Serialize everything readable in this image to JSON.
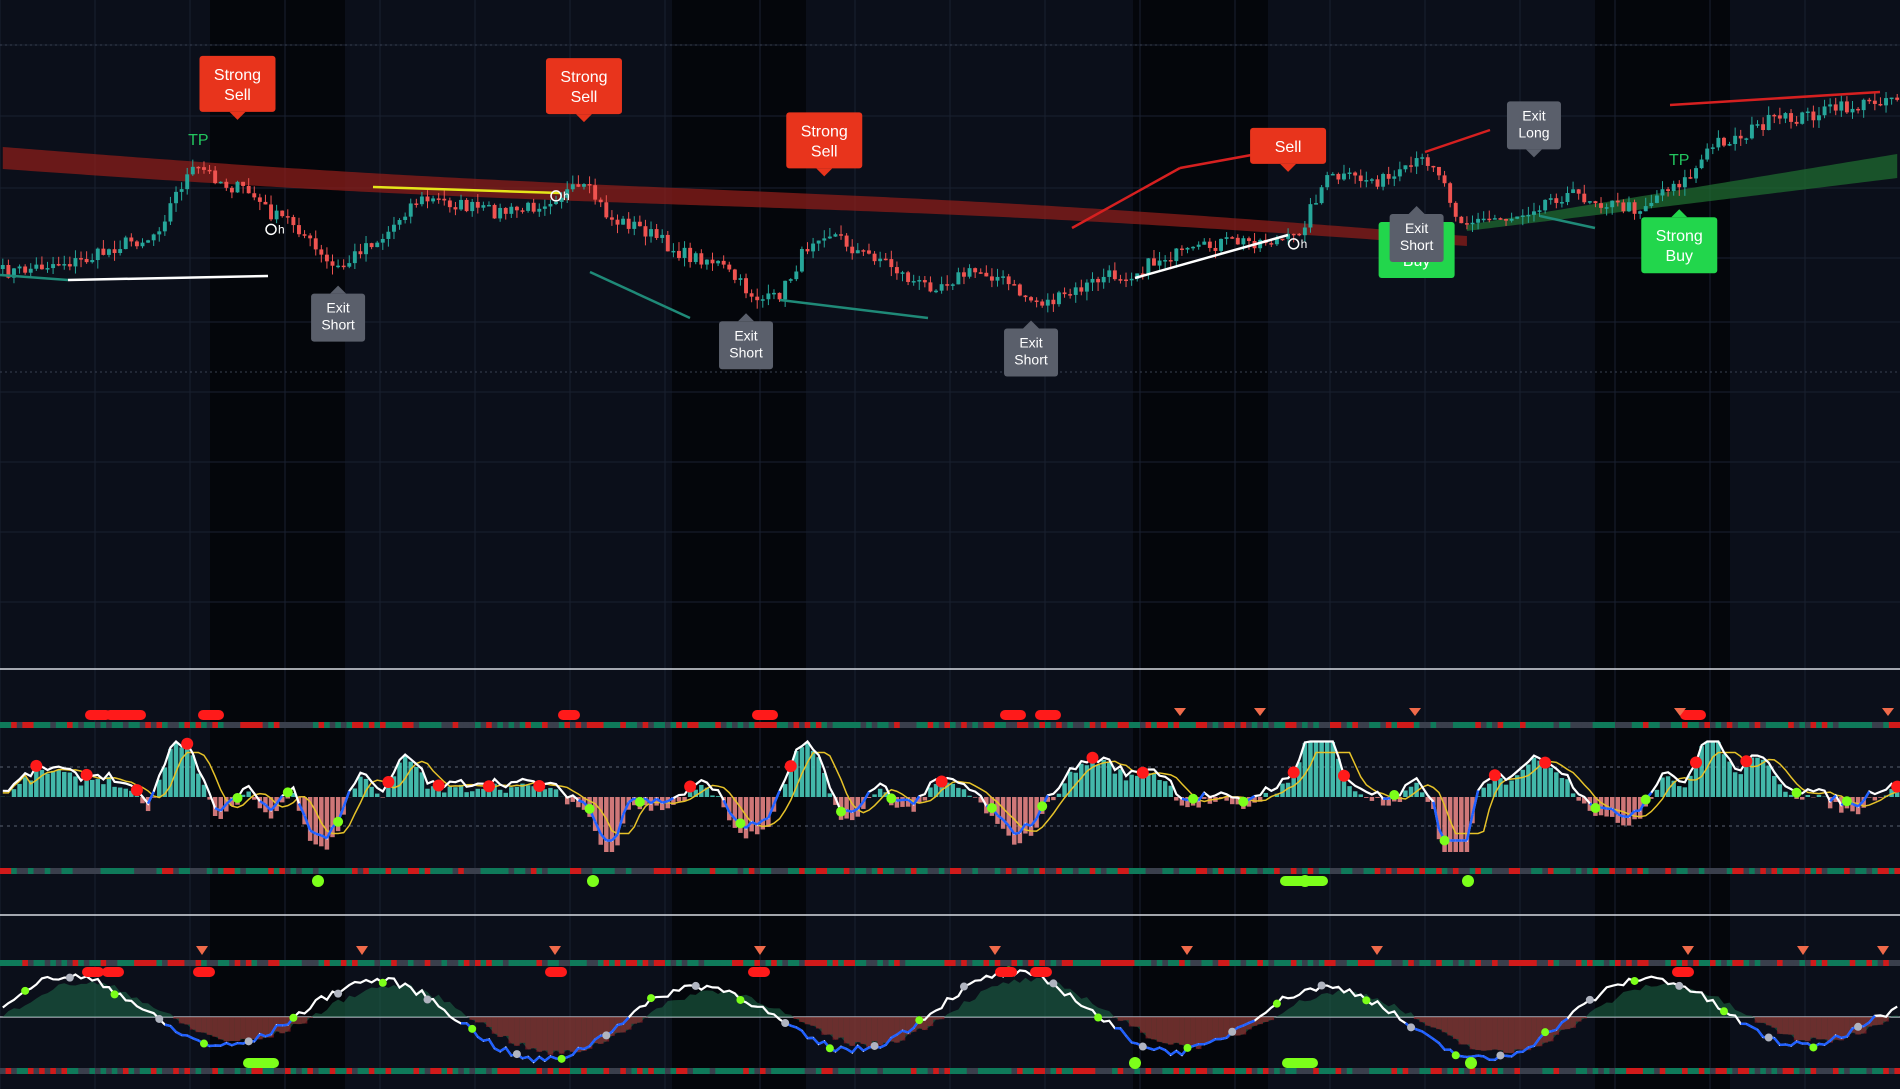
{
  "colors": {
    "background": "#0b0f1a",
    "shade": "#000000",
    "candle_up": "#26a69a",
    "candle_down": "#ef5350",
    "red_ribbon": "#8b1e1a",
    "green_ribbon": "#1f6b30",
    "sell_label": "#e8341c",
    "buy_label": "#22d64c",
    "exit_label": "#5a5f6b",
    "histogram_up": "#4dd6c4",
    "histogram_down": "#f28b8b",
    "wave_white": "#ffffff",
    "wave_blue": "#2060ff",
    "signal_yellow": "#e6c229",
    "dot_red": "#ff1a1a",
    "dot_green": "#7cff1a",
    "divergence_red": "#d62020",
    "divergence_white": "#ffffff",
    "divergence_teal": "#1f8a78",
    "divergence_yellow": "#e5e51a"
  },
  "chart_data": [
    {
      "type": "candlestick",
      "panel": "price",
      "signals": [
        {
          "text": [
            "Strong",
            "Sell"
          ],
          "kind": "sell",
          "bar": 42
        },
        {
          "text": [
            "Strong",
            "Sell"
          ],
          "kind": "sell",
          "bar": 104
        },
        {
          "text": [
            "Strong",
            "Sell"
          ],
          "kind": "sell",
          "bar": 147
        },
        {
          "text": [
            "Sell"
          ],
          "kind": "sell",
          "bar": 230
        },
        {
          "text": [
            "Strong",
            "Buy"
          ],
          "kind": "buy",
          "bar": 253
        },
        {
          "text": [
            "Strong",
            "Buy"
          ],
          "kind": "buy",
          "bar": 300
        },
        {
          "text": [
            "Exit",
            "Short"
          ],
          "kind": "exit",
          "bar": 60
        },
        {
          "text": [
            "Exit",
            "Short"
          ],
          "kind": "exit",
          "bar": 133
        },
        {
          "text": [
            "Exit",
            "Short"
          ],
          "kind": "exit",
          "bar": 184
        },
        {
          "text": [
            "Exit",
            "Short"
          ],
          "kind": "exit",
          "bar": 253
        },
        {
          "text": [
            "Exit",
            "Long"
          ],
          "kind": "exit",
          "bar": 274
        }
      ],
      "take_profit": [
        {
          "text": "TP",
          "bar": 35
        },
        {
          "text": "TP",
          "bar": 300
        }
      ],
      "pivot_marks": [
        {
          "text": "h",
          "bar": 48
        },
        {
          "text": "h",
          "bar": 99
        },
        {
          "text": "h",
          "bar": 231
        }
      ]
    },
    {
      "type": "histogram",
      "panel": "oscillator-1"
    },
    {
      "type": "area",
      "panel": "oscillator-2"
    }
  ]
}
